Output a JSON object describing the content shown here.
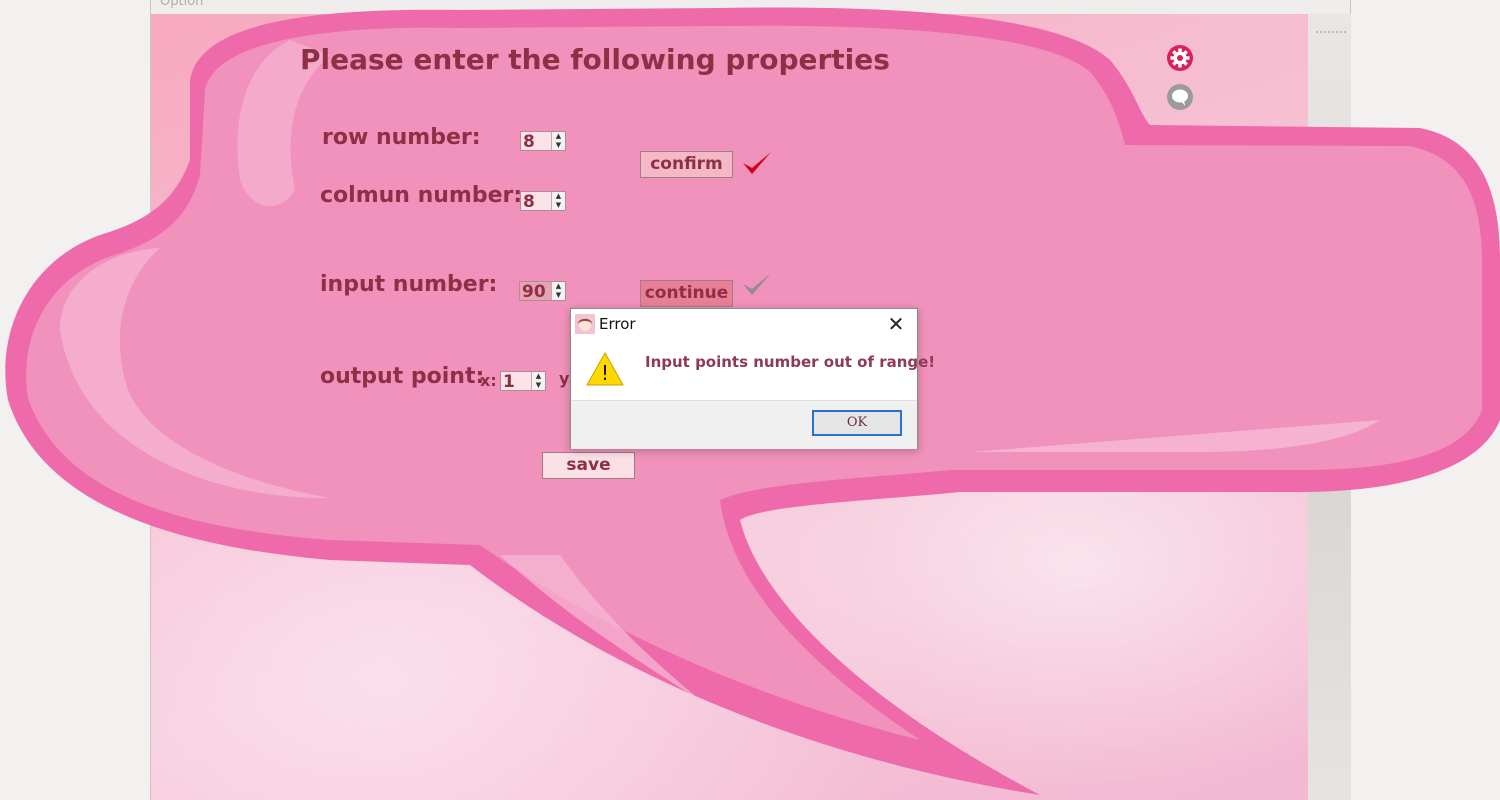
{
  "window": {
    "title": "Option"
  },
  "form": {
    "heading": "Please enter the following properties",
    "row_label": "row number:",
    "row_value": "8",
    "column_label": "colmun number:",
    "column_value": "8",
    "confirm_label": "confirm",
    "input_label": "input number:",
    "input_value": "90",
    "continue_label": "continue",
    "output_label": "output point:",
    "x_label": "x:",
    "x_value": "1",
    "y_label": "y",
    "save_label": "save"
  },
  "dialog": {
    "title": "Error",
    "message": "Input points number out of range!",
    "ok_label": "OK",
    "close_glyph": "✕",
    "warning_glyph": "!"
  },
  "icons": {
    "settings": "gear-icon",
    "chat": "speech-bubble-icon",
    "confirm_check": "check-icon",
    "continue_check": "check-icon",
    "dialog_app": "avatar-icon",
    "warning": "warning-icon"
  },
  "colors": {
    "text": "#8f2f46",
    "bubble_outer": "#ee6aaa",
    "bubble_inner": "#f092bb",
    "confirm_check": "#d0021b",
    "continue_check": "#8d8d8d",
    "gear": "#d9215a",
    "ok_border": "#2673c9"
  }
}
